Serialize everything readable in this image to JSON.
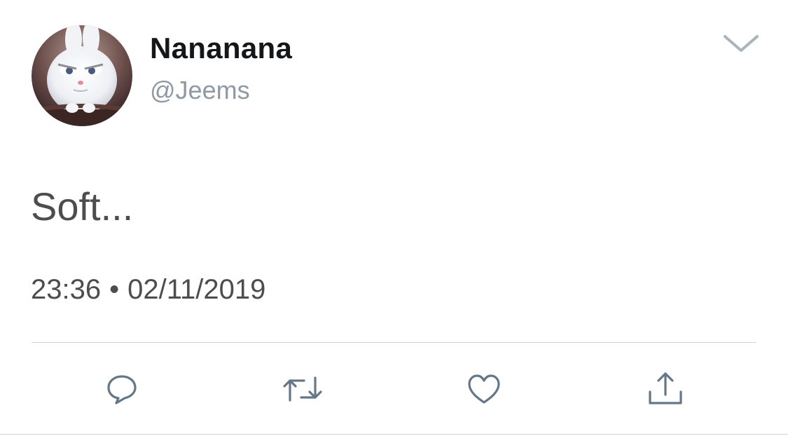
{
  "user": {
    "display_name": "Nananana",
    "handle": "@Jeems",
    "avatar_icon": "bunny-avatar"
  },
  "tweet": {
    "text": "Soft...",
    "time": "23:36",
    "separator": "•",
    "date": "02/11/2019"
  },
  "actions": [
    {
      "icon": "reply-icon"
    },
    {
      "icon": "retweet-icon"
    },
    {
      "icon": "like-icon"
    },
    {
      "icon": "share-icon"
    }
  ],
  "colors": {
    "name": "#14171a",
    "handle": "#8f99a3",
    "body_text": "#4d4d4d",
    "icon": "#657786",
    "divider": "#cfd5da"
  }
}
